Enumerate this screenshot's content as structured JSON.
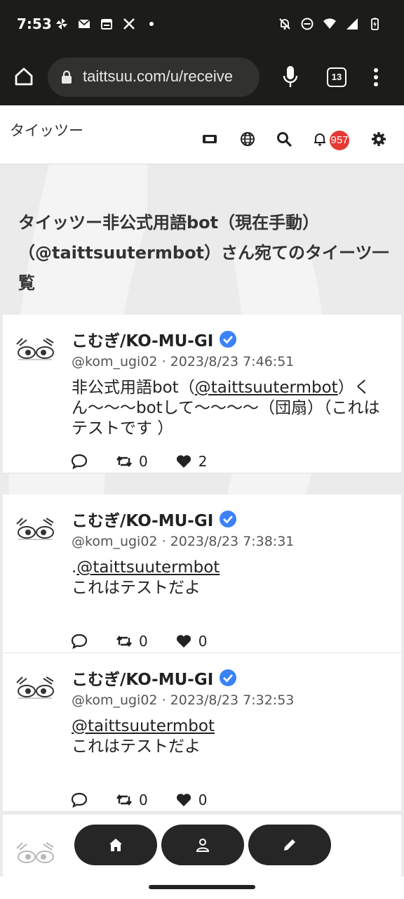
{
  "status_bar": {
    "time": "7:53",
    "left_icons": [
      "pinwheel-icon",
      "mail-icon",
      "calendar-icon",
      "x-logo-icon",
      "dot-icon"
    ],
    "right_icons": [
      "notifications-off-icon",
      "do-not-disturb-icon",
      "wifi-icon",
      "signal-icon",
      "battery-charging-icon"
    ]
  },
  "browser": {
    "url": "taittsuu.com/u/receive",
    "tab_count": "13"
  },
  "app": {
    "title": "タイッツー",
    "notification_count": "957"
  },
  "page": {
    "heading": "タイッツー非公式用語bot（現在手動）（@taittsuutermbot）さん宛てのタイーツ一覧"
  },
  "posts": [
    {
      "author": "こむぎ/KO-MU-GI",
      "handle": "@kom_ugi02",
      "separator": "·",
      "timestamp": "2023/8/23 7:46:51",
      "body_prefix": "非公式用語bot（",
      "mention": "@taittsuutermbot",
      "body_suffix": "）くん〜〜〜botして〜〜〜〜（団扇）（これはテストです ）",
      "retweets": "0",
      "likes": "2"
    },
    {
      "author": "こむぎ/KO-MU-GI",
      "handle": "@kom_ugi02",
      "separator": "·",
      "timestamp": "2023/8/23 7:38:31",
      "body_prefix": ".",
      "mention": "@taittsuutermbot",
      "body_suffix": "これはテストだよ",
      "retweets": "0",
      "likes": "0"
    },
    {
      "author": "こむぎ/KO-MU-GI",
      "handle": "@kom_ugi02",
      "separator": "·",
      "timestamp": "2023/8/23 7:32:53",
      "body_prefix": "",
      "mention": "@taittsuutermbot",
      "body_suffix": "これはテストだよ",
      "retweets": "0",
      "likes": "0"
    }
  ],
  "colors": {
    "badge": "#e53935",
    "verified": "#3b82f6",
    "bar": "#1c1c18"
  }
}
